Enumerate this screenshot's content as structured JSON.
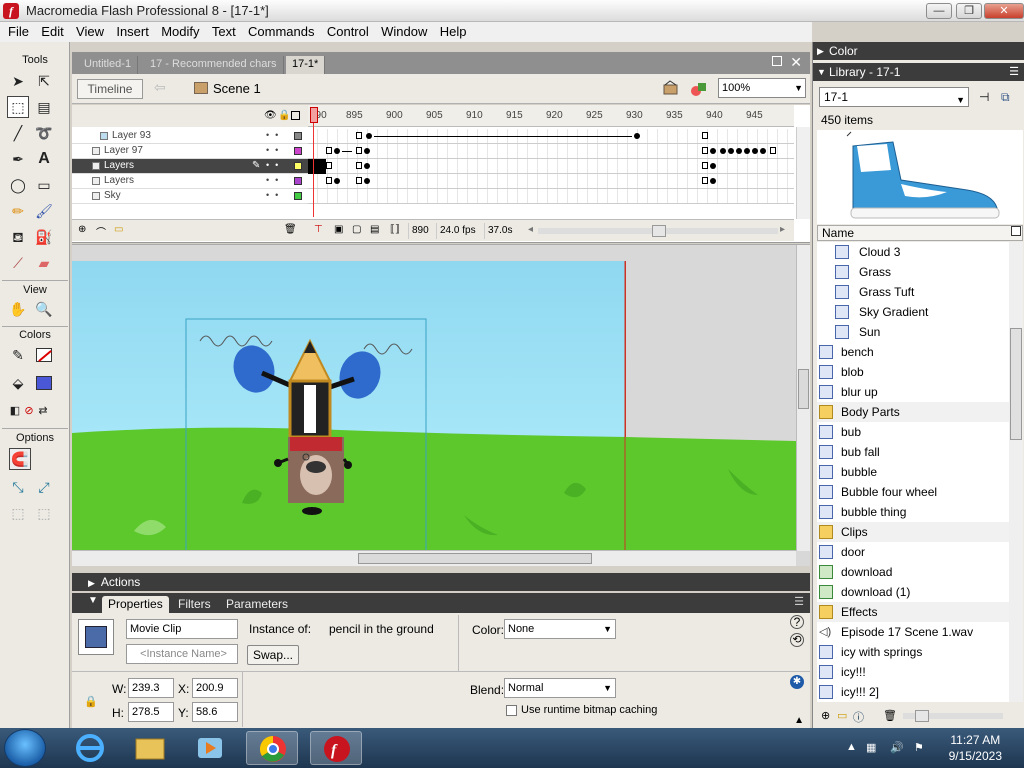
{
  "window": {
    "title": "Macromedia Flash Professional 8 - [17-1*]",
    "minimize": "—",
    "maximize": "❐",
    "close": "✕"
  },
  "menu": [
    "File",
    "Edit",
    "View",
    "Insert",
    "Modify",
    "Text",
    "Commands",
    "Control",
    "Window",
    "Help"
  ],
  "tools": {
    "title": "Tools",
    "view": "View",
    "colors": "Colors",
    "options": "Options"
  },
  "doc_tabs": [
    "Untitled-1",
    "17 - Recommended chars",
    "17-1*"
  ],
  "editbar": {
    "timeline_label": "Timeline",
    "scene_label": "Scene 1",
    "zoom_value": "100%"
  },
  "timeline": {
    "ruler": [
      "890",
      "895",
      "900",
      "905",
      "910",
      "915",
      "920",
      "925",
      "930",
      "935",
      "940",
      "945"
    ],
    "layers": [
      {
        "name": "Layer 93",
        "selected": false
      },
      {
        "name": "Layer 97",
        "selected": false
      },
      {
        "name": "Layers",
        "selected": true
      },
      {
        "name": "Layers",
        "selected": false
      },
      {
        "name": "Sky",
        "selected": false
      }
    ],
    "current_frame": "890",
    "fps": "24.0 fps",
    "elapsed": "37.0s"
  },
  "panels": {
    "actions": "Actions",
    "tabs": [
      "Properties",
      "Filters",
      "Parameters"
    ]
  },
  "properties": {
    "symbol_type": "Movie Clip",
    "instance_name_placeholder": "<Instance Name>",
    "instance_of_label": "Instance of:",
    "instance_of_value": "pencil in the ground",
    "swap_label": "Swap...",
    "color_label": "Color:",
    "color_value": "None",
    "blend_label": "Blend:",
    "blend_value": "Normal",
    "bitmap_caching_label": "Use runtime bitmap caching",
    "w_label": "W:",
    "w_value": "239.3",
    "x_label": "X:",
    "x_value": "200.9",
    "h_label": "H:",
    "h_value": "278.5",
    "y_label": "Y:",
    "y_value": "58.6"
  },
  "right_panel": {
    "color_title": "Color",
    "library_title": "Library - 17-1",
    "library_select": "17-1",
    "item_count": "450 items",
    "name_header": "Name",
    "items": [
      {
        "name": "Cloud 3",
        "type": "symbol",
        "indent": true
      },
      {
        "name": "Grass",
        "type": "symbol",
        "indent": true
      },
      {
        "name": "Grass Tuft",
        "type": "symbol",
        "indent": true
      },
      {
        "name": "Sky Gradient",
        "type": "symbol",
        "indent": true
      },
      {
        "name": "Sun",
        "type": "symbol",
        "indent": true
      },
      {
        "name": "bench",
        "type": "symbol",
        "indent": false
      },
      {
        "name": "blob",
        "type": "symbol",
        "indent": false
      },
      {
        "name": "blur up",
        "type": "symbol",
        "indent": false
      },
      {
        "name": "Body Parts",
        "type": "folder",
        "indent": false
      },
      {
        "name": "bub",
        "type": "symbol",
        "indent": false
      },
      {
        "name": "bub fall",
        "type": "symbol",
        "indent": false
      },
      {
        "name": "bubble",
        "type": "symbol",
        "indent": false
      },
      {
        "name": "Bubble four wheel",
        "type": "symbol",
        "indent": false
      },
      {
        "name": "bubble thing",
        "type": "symbol",
        "indent": false
      },
      {
        "name": "Clips",
        "type": "folder",
        "indent": false
      },
      {
        "name": "door",
        "type": "symbol",
        "indent": false
      },
      {
        "name": "download",
        "type": "bitmap",
        "indent": false
      },
      {
        "name": "download (1)",
        "type": "bitmap",
        "indent": false
      },
      {
        "name": "Effects",
        "type": "folder",
        "indent": false
      },
      {
        "name": "Episode 17 Scene 1.wav",
        "type": "sound",
        "indent": false
      },
      {
        "name": "icy with springs",
        "type": "symbol",
        "indent": false
      },
      {
        "name": "icy!!!",
        "type": "symbol",
        "indent": false
      },
      {
        "name": "icy!!! 2]",
        "type": "symbol",
        "indent": false
      }
    ]
  },
  "taskbar": {
    "time": "11:27 AM",
    "date": "9/15/2023"
  },
  "colors": {
    "accent": "#3c3c3c",
    "sky": "#a6e6f8",
    "grass": "#5cc82c",
    "selection": "#454545"
  }
}
